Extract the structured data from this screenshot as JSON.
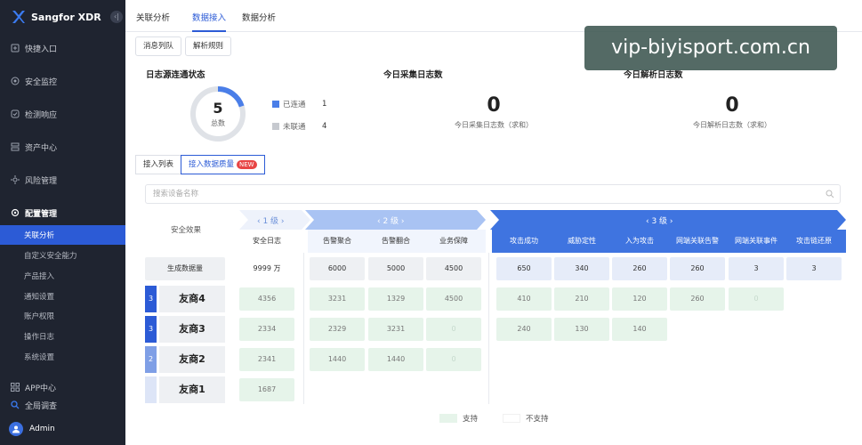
{
  "app": {
    "brand": "Sangfor XDR",
    "collapse_glyph": "‹|"
  },
  "sidebar": {
    "items": [
      {
        "label": "快捷入口",
        "icon": "shortcut-icon"
      },
      {
        "label": "安全监控",
        "icon": "monitor-icon"
      },
      {
        "label": "检测响应",
        "icon": "detect-icon"
      },
      {
        "label": "资产中心",
        "icon": "asset-icon"
      },
      {
        "label": "风险管理",
        "icon": "risk-icon"
      },
      {
        "label": "配置管理",
        "icon": "config-icon"
      }
    ],
    "sub_items": [
      {
        "label": "关联分析",
        "active": true
      },
      {
        "label": "自定义安全能力"
      },
      {
        "label": "产品接入"
      },
      {
        "label": "通知设置"
      },
      {
        "label": "账户权限"
      },
      {
        "label": "操作日志"
      },
      {
        "label": "系统设置"
      }
    ],
    "app_center": "APP中心",
    "global_search": "全局调查",
    "user": "Admin"
  },
  "top_tabs": [
    {
      "label": "关联分析"
    },
    {
      "label": "数据接入",
      "active": true
    },
    {
      "label": "数据分析"
    }
  ],
  "sub_tabs": [
    "消息列队",
    "解析规则"
  ],
  "status": {
    "title": "日志源连通状态",
    "total": "5",
    "total_label": "总数",
    "connected_label": "已连通",
    "connected_value": "1",
    "disconnected_label": "未联通",
    "disconnected_value": "4",
    "connected_fraction": 0.2
  },
  "collect": {
    "title": "今日采集日志数",
    "value": "0",
    "sub": "今日采集日志数（求和）"
  },
  "parse": {
    "title": "今日解析日志数",
    "value": "0",
    "sub": "今日解析日志数（求和）"
  },
  "list_tabs": {
    "list": "接入列表",
    "quality": "接入数据质量",
    "badge": "NEW"
  },
  "search": {
    "placeholder": "搜索设备名称"
  },
  "matrix": {
    "row_header": "安全效果",
    "levels": [
      "‹ 1 级 ›",
      "‹ 2 级 ›",
      "‹ 3 级 ›"
    ],
    "columns": [
      "安全日志",
      "告警聚合",
      "告警翻合",
      "业务保障",
      "攻击成功",
      "威胁定性",
      "入为攻击",
      "网端关联告警",
      "网端关联事件",
      "攻击链还原"
    ],
    "generated_label": "生成数据量",
    "generated": [
      "9999 万",
      "6000",
      "5000",
      "4500",
      "650",
      "340",
      "260",
      "260",
      "3",
      "3"
    ],
    "vendors": [
      {
        "num": "3",
        "name": "友商4",
        "values": [
          "4356",
          "3231",
          "1329",
          "4500",
          "410",
          "210",
          "120",
          "260",
          "0"
        ]
      },
      {
        "num": "3",
        "name": "友商3",
        "values": [
          "2334",
          "2329",
          "3231",
          "0",
          "240",
          "130",
          "140"
        ]
      },
      {
        "num": "2",
        "name": "友商2",
        "values": [
          "2341",
          "1440",
          "1440",
          "0"
        ]
      },
      {
        "num": "",
        "name": "友商1",
        "values": [
          "1687"
        ]
      }
    ]
  },
  "legend": {
    "supported": "支持",
    "unsupported": "不支持"
  },
  "watermark": "vip-biyisport.com.cn",
  "colors": {
    "primary": "#2c5bd6",
    "sidebar": "#1f2430",
    "support": "#e6f4ea"
  }
}
